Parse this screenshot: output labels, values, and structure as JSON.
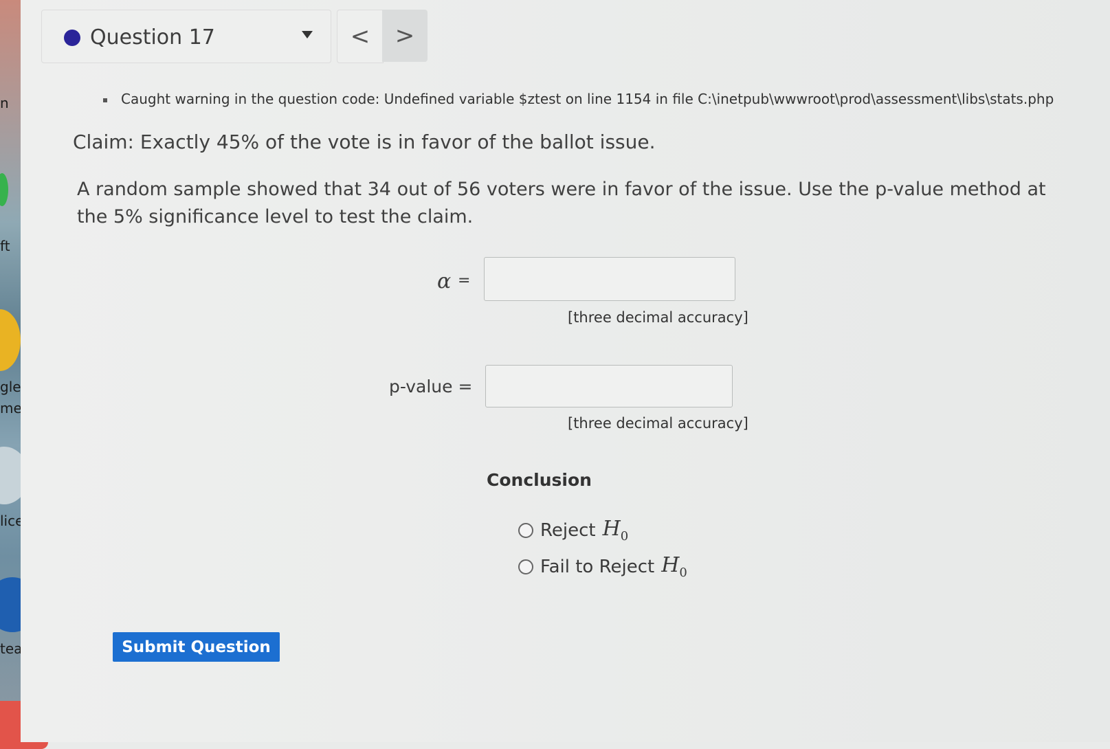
{
  "desktop": {
    "items": [
      "n",
      "ft",
      "gle",
      "me",
      "lice",
      "team"
    ]
  },
  "question_nav": {
    "title": "Question 17",
    "prev_glyph": "<",
    "next_glyph": ">"
  },
  "warning": "Caught warning in the question code: Undefined variable $ztest on line 1154 in file C:\\inetpub\\wwwroot\\prod\\assessment\\libs\\stats.php",
  "claim": "Claim: Exactly 45% of the vote is in favor of the ballot issue.",
  "problem": "A random sample showed that 34 out of 56 voters were in favor of the issue. Use the p-value method at the 5% significance level to test the claim.",
  "alpha": {
    "symbol": "α",
    "eq": "=",
    "value": "",
    "hint": "[three decimal accuracy]"
  },
  "pvalue": {
    "label": "p-value =",
    "value": "",
    "hint": "[three decimal accuracy]"
  },
  "conclusion": {
    "title": "Conclusion",
    "options": [
      {
        "text": "Reject",
        "h": "H",
        "sub": "0"
      },
      {
        "text": "Fail to Reject",
        "h": "H",
        "sub": "0"
      }
    ]
  },
  "submit_label": "Submit Question"
}
